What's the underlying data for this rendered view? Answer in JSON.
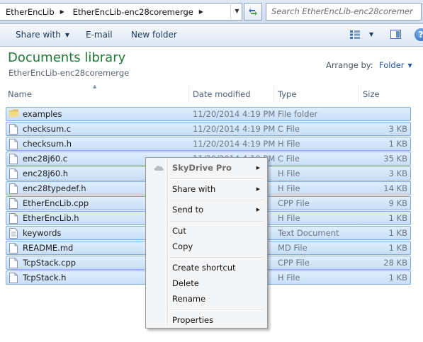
{
  "address_bar": {
    "crumbs": [
      "EtherEncLib",
      "EtherEncLib-enc28coremerge"
    ],
    "search_placeholder": "Search EtherEncLib-enc28coremerge"
  },
  "command_bar": {
    "share_with": "Share with",
    "email": "E-mail",
    "new_folder": "New folder"
  },
  "library": {
    "title": "Documents library",
    "subtitle": "EtherEncLib-enc28coremerge",
    "arrange_by_label": "Arrange by:",
    "arrange_by_value": "Folder"
  },
  "columns": {
    "name": "Name",
    "date_modified": "Date modified",
    "type": "Type",
    "size": "Size"
  },
  "files": [
    {
      "name": "examples",
      "date": "11/20/2014 4:19 PM",
      "type": "File folder",
      "size": "",
      "icon": "folder-icon"
    },
    {
      "name": "checksum.c",
      "date": "11/20/2014 4:19 PM",
      "type": "C File",
      "size": "3 KB",
      "icon": "file-icon"
    },
    {
      "name": "checksum.h",
      "date": "11/20/2014 4:19 PM",
      "type": "H File",
      "size": "1 KB",
      "icon": "file-icon"
    },
    {
      "name": "enc28j60.c",
      "date": "11/20/2014 4:19 PM",
      "type": "C File",
      "size": "35 KB",
      "icon": "file-icon"
    },
    {
      "name": "enc28j60.h",
      "date": "",
      "type": "H File",
      "size": "3 KB",
      "icon": "file-icon"
    },
    {
      "name": "enc28typedef.h",
      "date": "",
      "type": "H File",
      "size": "14 KB",
      "icon": "file-icon"
    },
    {
      "name": "EtherEncLib.cpp",
      "date": "",
      "type": "CPP File",
      "size": "9 KB",
      "icon": "file-icon"
    },
    {
      "name": "EtherEncLib.h",
      "date": "",
      "type": "H File",
      "size": "1 KB",
      "icon": "file-icon"
    },
    {
      "name": "keywords",
      "date": "",
      "type": "Text Document",
      "size": "1 KB",
      "icon": "text-file-icon"
    },
    {
      "name": "README.md",
      "date": "",
      "type": "MD File",
      "size": "1 KB",
      "icon": "file-icon"
    },
    {
      "name": "TcpStack.cpp",
      "date": "",
      "type": "CPP File",
      "size": "28 KB",
      "icon": "file-icon"
    },
    {
      "name": "TcpStack.h",
      "date": "",
      "type": "H File",
      "size": "1 KB",
      "icon": "file-icon"
    }
  ],
  "context_menu": {
    "skydrive": "SkyDrive Pro",
    "share_with": "Share with",
    "send_to": "Send to",
    "cut": "Cut",
    "copy": "Copy",
    "create_shortcut": "Create shortcut",
    "delete": "Delete",
    "rename": "Rename",
    "properties": "Properties"
  },
  "colors": {
    "library_title": "#1e7a32",
    "link_blue": "#1f58a7",
    "selection_fill": "#cde2f8",
    "selection_border": "#84acdd"
  }
}
